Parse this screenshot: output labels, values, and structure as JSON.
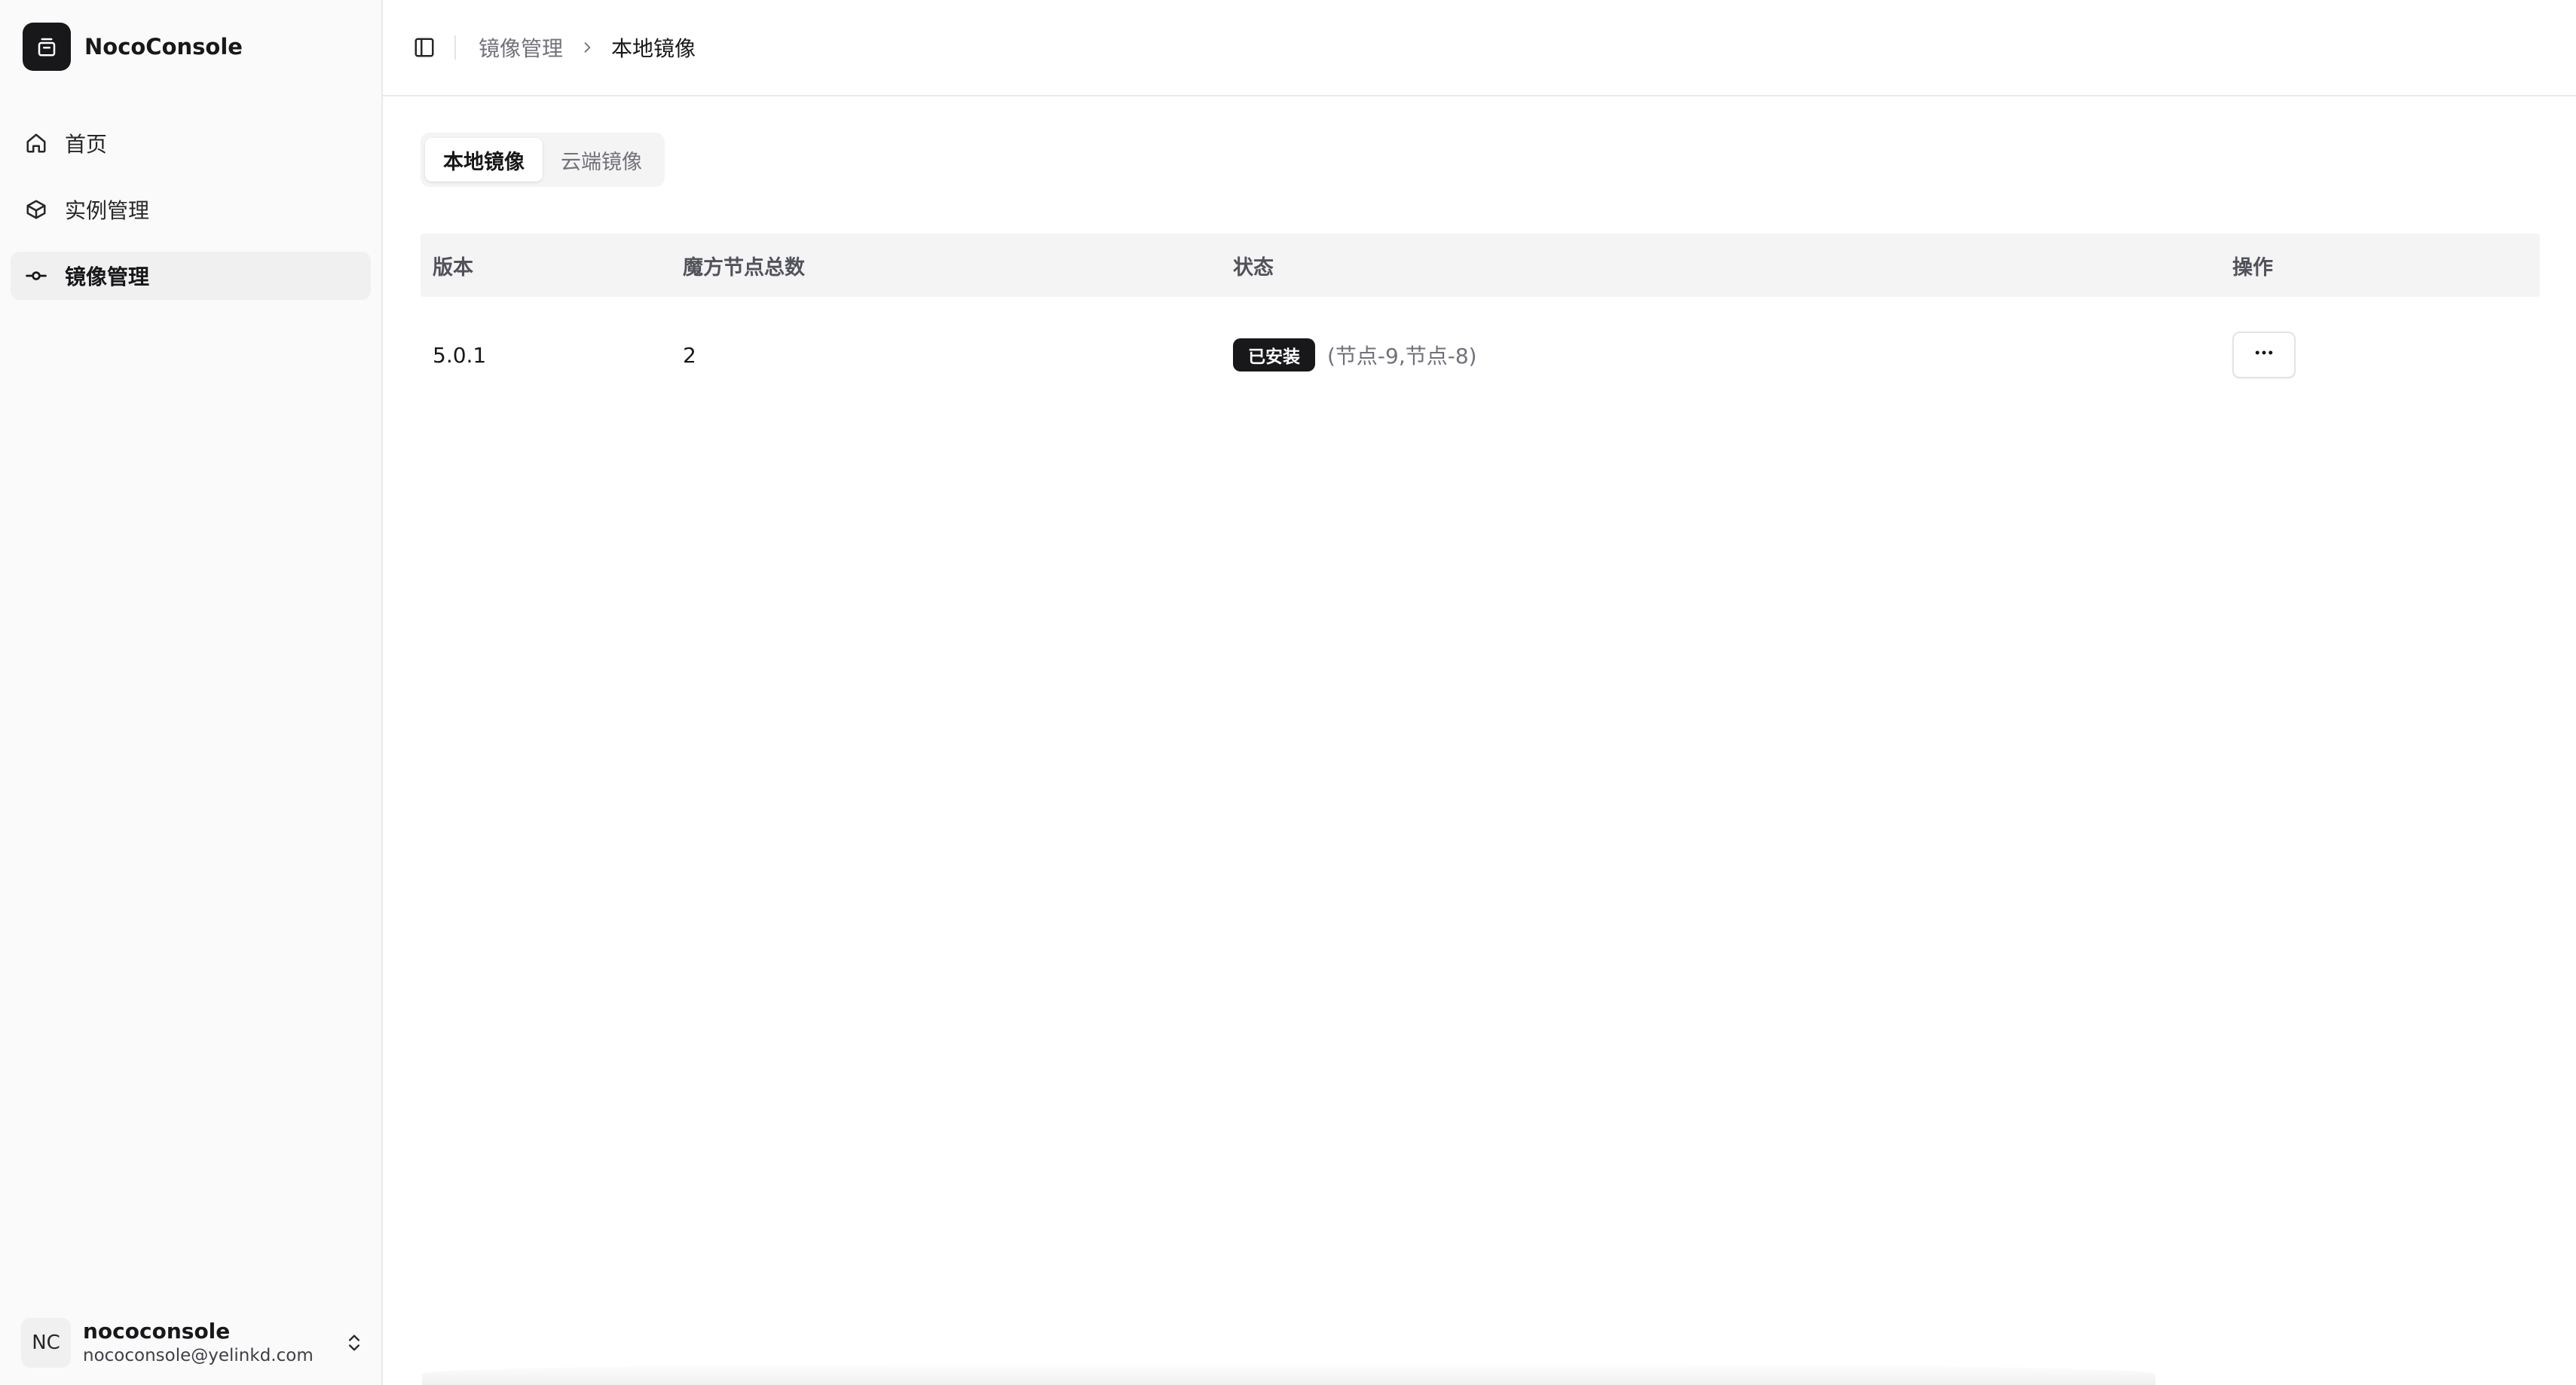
{
  "app": {
    "name": "NocoConsole"
  },
  "sidebar": {
    "items": [
      {
        "label": "首页",
        "icon": "home-icon",
        "active": false
      },
      {
        "label": "实例管理",
        "icon": "box-icon",
        "active": false
      },
      {
        "label": "镜像管理",
        "icon": "git-commit-icon",
        "active": true
      }
    ]
  },
  "user": {
    "initials": "NC",
    "name": "nococonsole",
    "email": "nococonsole@yelinkd.com"
  },
  "breadcrumb": {
    "parent": "镜像管理",
    "current": "本地镜像"
  },
  "tabs": [
    {
      "label": "本地镜像",
      "active": true
    },
    {
      "label": "云端镜像",
      "active": false
    }
  ],
  "table": {
    "headers": {
      "version": "版本",
      "nodes": "魔方节点总数",
      "status": "状态",
      "actions": "操作"
    },
    "rows": [
      {
        "version": "5.0.1",
        "nodes": "2",
        "status_badge": "已安装",
        "status_nodes": "(节点-9,节点-8)"
      }
    ]
  },
  "colors": {
    "primary": "#18181b",
    "muted": "#71717a",
    "sidebar_bg": "#fafafa",
    "header_bg": "#f4f4f5"
  }
}
